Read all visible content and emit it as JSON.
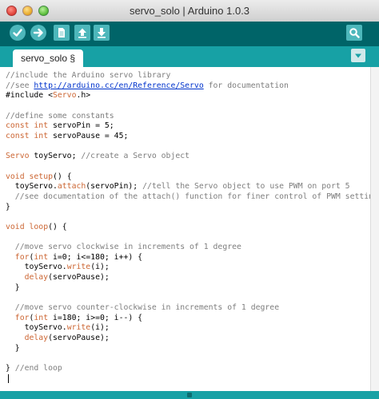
{
  "window": {
    "title": "servo_solo | Arduino 1.0.3"
  },
  "toolbar": {
    "buttons": [
      {
        "icon": "checkmark-icon"
      },
      {
        "icon": "arrow-right-icon"
      },
      {
        "icon": "new-document-icon"
      },
      {
        "icon": "open-arrow-up-icon"
      },
      {
        "icon": "save-arrow-down-icon"
      },
      {
        "icon": "serial-monitor-search-icon"
      }
    ]
  },
  "tabs": [
    {
      "label": "servo_solo §"
    }
  ],
  "editor": {
    "lines": [
      "//include the Arduino servo library",
      "//see http://arduino.cc/en/Reference/Servo for documentation",
      "#include <Servo.h>",
      "",
      "//define some constants",
      "const int servoPin = 5;",
      "const int servoPause = 45;",
      "",
      "Servo toyServo; //create a Servo object",
      "",
      "void setup() {",
      "  toyServo.attach(servoPin); //tell the Servo object to use PWM on port 5",
      "  //see documentation of the attach() function for finer control of PWM settings",
      "}",
      "",
      "void loop() {",
      "",
      "  //move servo clockwise in increments of 1 degree",
      "  for(int i=0; i<=180; i++) {",
      "    toyServo.write(i);",
      "    delay(servoPause);",
      "  }",
      "",
      "  //move servo counter-clockwise in increments of 1 degree",
      "  for(int i=180; i>=0; i--) {",
      "    toyServo.write(i);",
      "    delay(servoPause);",
      "  }",
      "",
      "} //end loop"
    ]
  },
  "colors": {
    "toolbar": "#006468",
    "tabbar": "#17a1a5",
    "button": "#4db7bb",
    "comment": "#7e7e7e",
    "keyword": "#cc6633",
    "link": "#0033cc"
  }
}
